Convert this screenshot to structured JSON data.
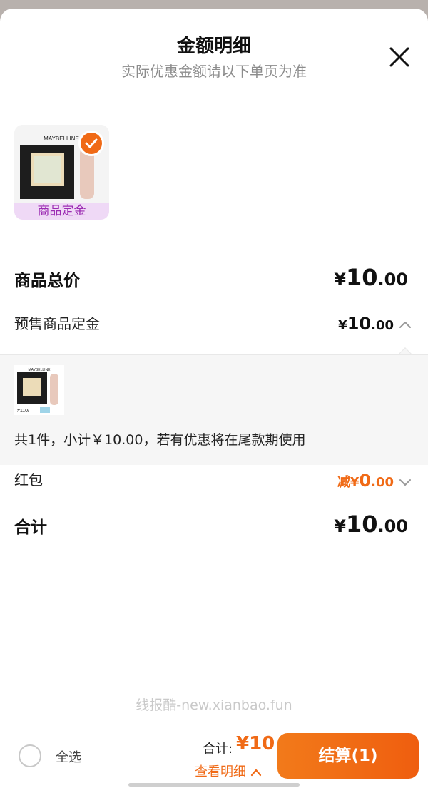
{
  "header": {
    "title": "金额明细",
    "subtitle": "实际优惠金额请以下单页为准"
  },
  "product": {
    "brand": "MAYBELLINE",
    "tag": "商品定金",
    "variant_label": "#110/"
  },
  "rows": {
    "total_price": {
      "label": "商品总价",
      "yen": "¥",
      "int": "10",
      "dec": ".00"
    },
    "presale_deposit": {
      "label": "预售商品定金",
      "yen": "¥",
      "int": "10",
      "dec": ".00"
    },
    "red_packet": {
      "label": "红包",
      "prefix": "减",
      "yen": "¥",
      "int": "0",
      "dec": ".00"
    },
    "subtotal": {
      "label": "合计",
      "yen": "¥",
      "int": "10",
      "dec": ".00"
    }
  },
  "detail": {
    "summary": "共1件，小计￥10.00，若有优惠将在尾款期使用"
  },
  "watermark": "线报酷-new.xianbao.fun",
  "footer": {
    "select_all": "全选",
    "total_label": "合计:",
    "total_amount": "¥10",
    "view_detail": "查看明细",
    "checkout": "结算(1)"
  },
  "colors": {
    "accent": "#f06a16",
    "tag_bg": "#efd9f6",
    "tag_text": "#9b2bb2"
  }
}
